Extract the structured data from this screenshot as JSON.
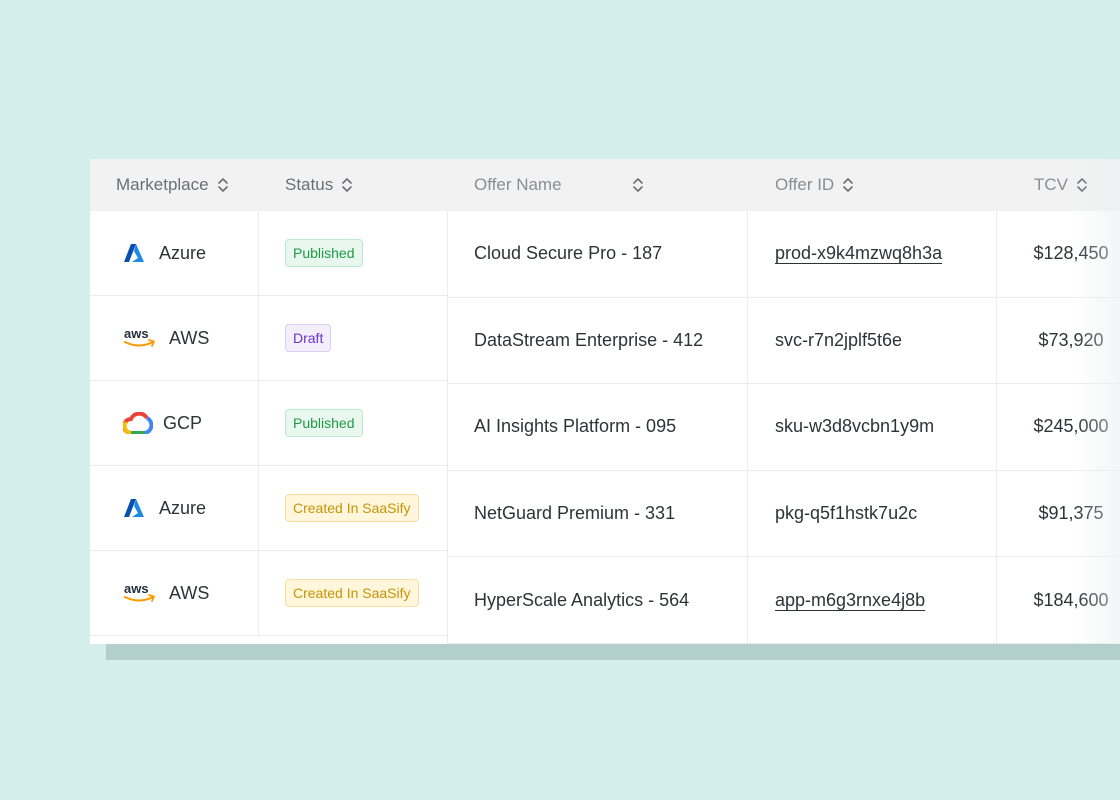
{
  "columns": {
    "marketplace": "Marketplace",
    "status": "Status",
    "offer_name": "Offer Name",
    "offer_id": "Offer ID",
    "tcv": "TCV"
  },
  "rows": [
    {
      "marketplace": "Azure",
      "logo": "azure-logo",
      "status": "Published",
      "status_kind": "published",
      "offer_name": "Cloud Secure Pro - 187",
      "offer_id": "prod-x9k4mzwq8h3a",
      "offer_id_link": true,
      "tcv": "$128,450"
    },
    {
      "marketplace": "AWS",
      "logo": "aws-logo",
      "status": "Draft",
      "status_kind": "draft",
      "offer_name": "DataStream Enterprise - 412",
      "offer_id": "svc-r7n2jplf5t6e",
      "offer_id_link": false,
      "tcv": "$73,920"
    },
    {
      "marketplace": "GCP",
      "logo": "gcp-logo",
      "status": "Published",
      "status_kind": "published",
      "offer_name": "AI Insights Platform - 095",
      "offer_id": "sku-w3d8vcbn1y9m",
      "offer_id_link": false,
      "tcv": "$245,000"
    },
    {
      "marketplace": "Azure",
      "logo": "azure-logo",
      "status": "Created In SaaSify",
      "status_kind": "created",
      "offer_name": "NetGuard Premium - 331",
      "offer_id": "pkg-q5f1hstk7u2c",
      "offer_id_link": false,
      "tcv": "$91,375"
    },
    {
      "marketplace": "AWS",
      "logo": "aws-logo",
      "status": "Created In SaaSify",
      "status_kind": "created",
      "offer_name": "HyperScale Analytics - 564",
      "offer_id": "app-m6g3rnxe4j8b",
      "offer_id_link": true,
      "tcv": "$184,600"
    }
  ],
  "icons": {
    "sort": "sort-updown-icon",
    "azure": "azure-logo",
    "aws": "aws-logo",
    "gcp": "gcp-logo"
  },
  "colors": {
    "background": "#d4eeec",
    "header_bg": "#f2f2f2",
    "published": "#1e9a46",
    "draft": "#6b35c9",
    "created": "#c69405",
    "azure": "#0a6fd6"
  }
}
